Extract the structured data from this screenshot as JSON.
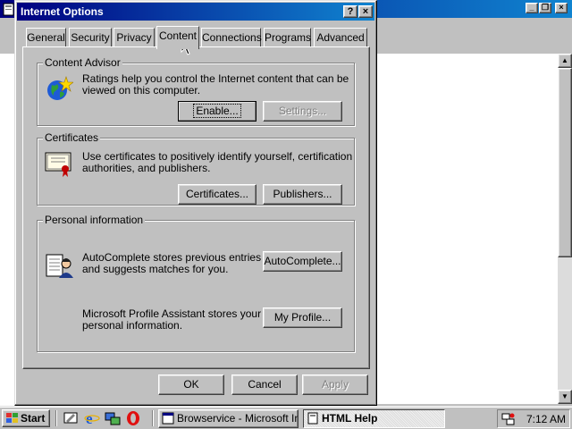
{
  "background_window": {
    "title": "",
    "controls": [
      "_",
      "❐",
      "×"
    ]
  },
  "dialog": {
    "title": "Internet Options",
    "controls": {
      "help": "?",
      "close": "×"
    },
    "tabs": [
      {
        "label": "General"
      },
      {
        "label": "Security"
      },
      {
        "label": "Privacy"
      },
      {
        "label": "Content",
        "active": true
      },
      {
        "label": "Connections"
      },
      {
        "label": "Programs"
      },
      {
        "label": "Advanced"
      }
    ],
    "content_advisor": {
      "label": "Content Advisor",
      "text_line1": "Ratings help you control the Internet content that can be",
      "text_line2": "viewed on this computer.",
      "enable_button": "Enable...",
      "settings_button": "Settings..."
    },
    "certificates": {
      "label": "Certificates",
      "text_line1": "Use certificates to positively identify yourself, certification",
      "text_line2": "authorities, and publishers.",
      "certificates_button": "Certificates...",
      "publishers_button": "Publishers..."
    },
    "personal_information": {
      "label": "Personal information",
      "autocomplete_line1": "AutoComplete stores previous entries",
      "autocomplete_line2": "and suggests matches for you.",
      "autocomplete_button": "AutoComplete...",
      "profile_line1": "Microsoft Profile Assistant stores your",
      "profile_line2": "personal information.",
      "profile_button": "My Profile..."
    },
    "buttons": {
      "ok": "OK",
      "cancel": "Cancel",
      "apply": "Apply"
    }
  },
  "taskbar": {
    "start_label": "Start",
    "quick_launch": [
      "desktop-icon",
      "ie-icon",
      "channels-icon",
      "opera-icon"
    ],
    "tasks": [
      {
        "label": "Browservice - Microsoft Int...",
        "active": false
      },
      {
        "label": "HTML Help",
        "active": true
      }
    ],
    "clock": "7:12 AM"
  },
  "colors": {
    "title_active_start": "#000080",
    "title_active_end": "#1084d0",
    "face": "#c0c0c0"
  }
}
